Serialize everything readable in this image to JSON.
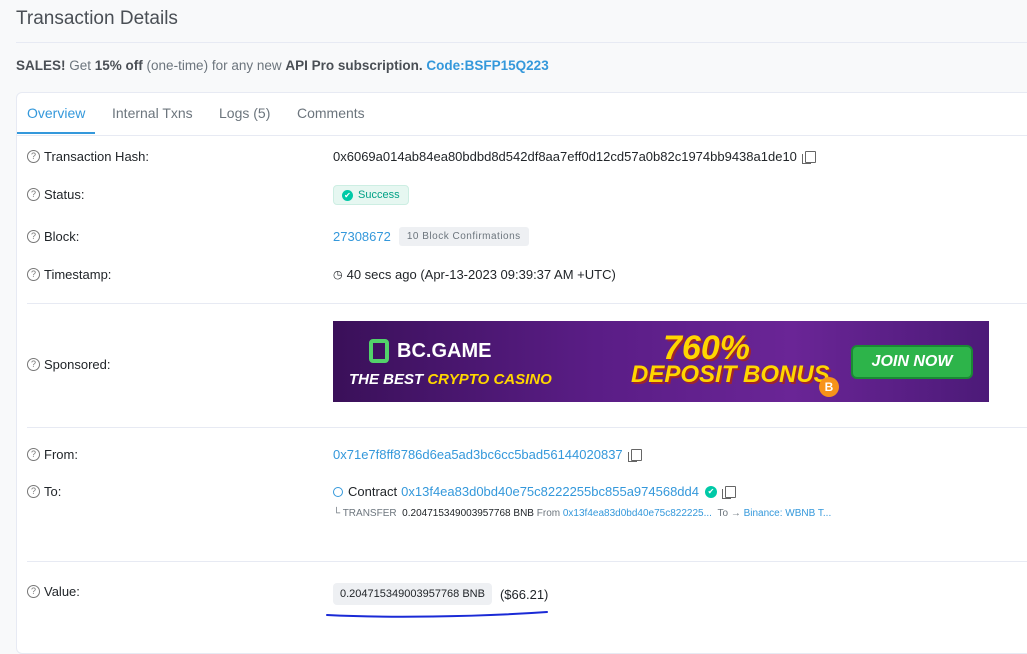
{
  "header": {
    "title": "Transaction Details"
  },
  "promo": {
    "prefix": "SALES!",
    "text1": " Get ",
    "discount": "15% off",
    "text2": " (one-time) for any new ",
    "product": "API Pro subscription.",
    "code": "Code:BSFP15Q223"
  },
  "tabs": [
    {
      "label": "Overview"
    },
    {
      "label": "Internal Txns"
    },
    {
      "label": "Logs (5)"
    },
    {
      "label": "Comments"
    }
  ],
  "fields": {
    "tx_hash": {
      "label": "Transaction Hash:",
      "value": "0x6069a014ab84ea80bdbd8d542df8aa7eff0d12cd57a0b82c1974bb9438a1de10"
    },
    "status": {
      "label": "Status:",
      "value": "Success"
    },
    "block": {
      "label": "Block:",
      "value": "27308672",
      "confirmations": "10 Block Confirmations"
    },
    "timestamp": {
      "label": "Timestamp:",
      "value": "40 secs ago (Apr-13-2023 09:39:37 AM +UTC)"
    },
    "sponsored": {
      "label": "Sponsored:"
    },
    "from": {
      "label": "From:",
      "value": "0x71e7f8ff8786d6ea5ad3bc6cc5bad56144020837"
    },
    "to": {
      "label": "To:",
      "prefix": "Contract",
      "value": "0x13f4ea83d0bd40e75c8222255bc855a974568dd4"
    },
    "transfer": {
      "kind": "TRANSFER",
      "amount": "0.204715349003957768 BNB",
      "from_label": "From",
      "from_value": "0x13f4ea83d0bd40e75c822225...",
      "to_label": "To",
      "to_value": "Binance: WBNB T..."
    },
    "value": {
      "label": "Value:",
      "amount": "0.204715349003957768 BNB",
      "usd": "($66.21)"
    }
  },
  "banner": {
    "brand": "BC.GAME",
    "tagline_1": "THE BEST ",
    "tagline_2": "CRYPTO CASINO",
    "percent": "760%",
    "bonus": "DEPOSIT BONUS",
    "cta": "JOIN NOW",
    "coin": "B"
  },
  "icons": {
    "help": "question-circle-icon",
    "copy": "copy-icon",
    "clock": "clock-icon",
    "check": "check-circle-icon",
    "search": "search-icon"
  },
  "colors": {
    "link": "#3498db",
    "success": "#00a186",
    "title": "#4a4f55"
  }
}
